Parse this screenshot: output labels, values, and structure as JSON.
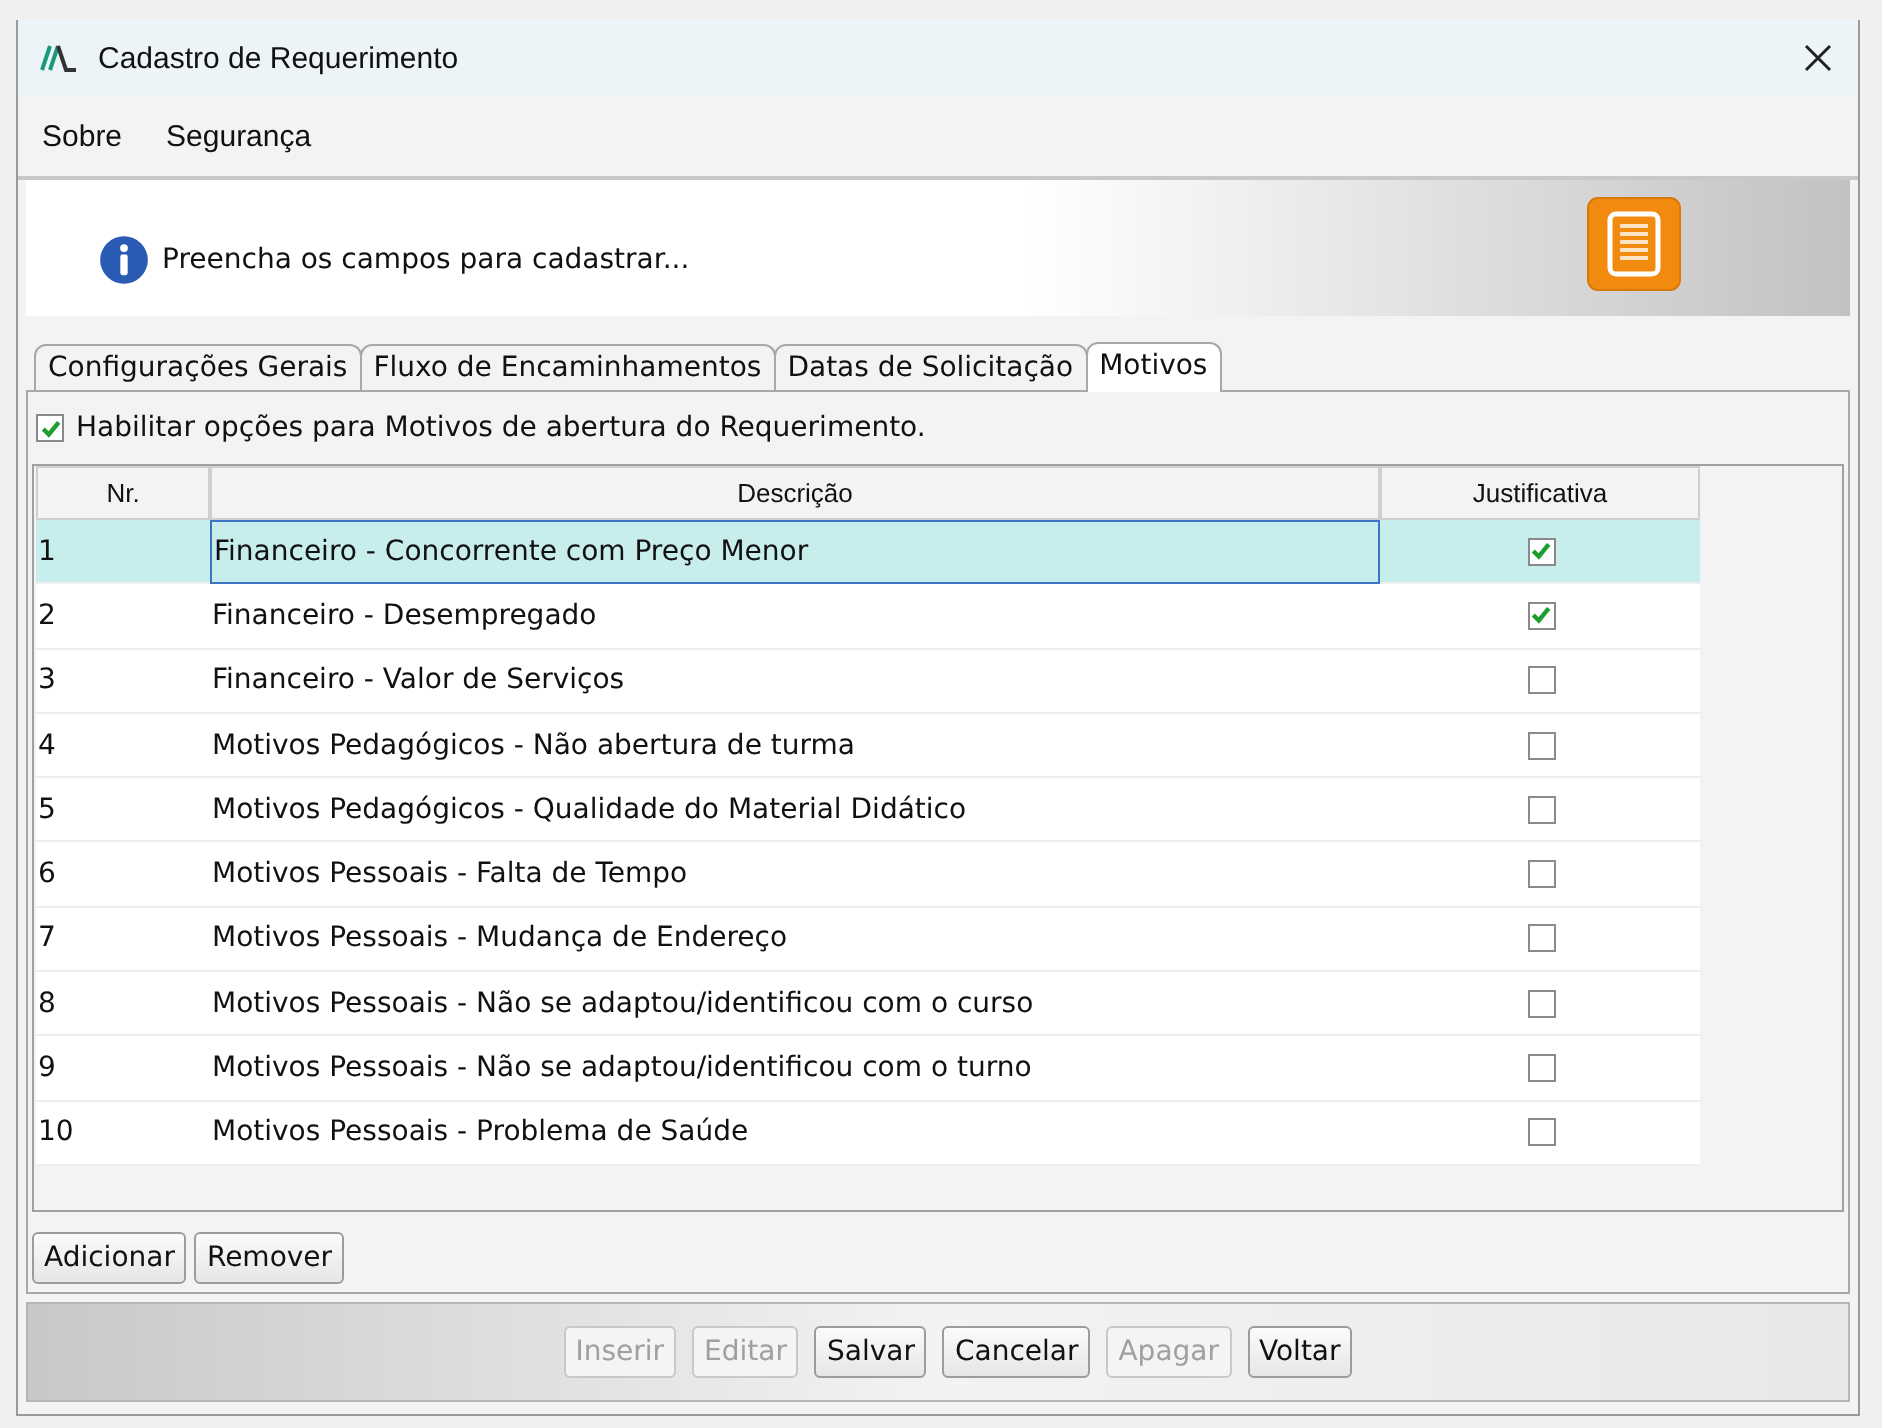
{
  "window": {
    "title": "Cadastro de Requerimento"
  },
  "menu": [
    "Sobre",
    "Segurança"
  ],
  "header": {
    "message": "Preencha os campos para cadastrar..."
  },
  "tabs": [
    {
      "label": "Configurações Gerais",
      "selected": false
    },
    {
      "label": "Fluxo de Encaminhamentos",
      "selected": false
    },
    {
      "label": "Datas de Solicitação",
      "selected": false
    },
    {
      "label": "Motivos",
      "selected": true
    }
  ],
  "enable_option": {
    "label": "Habilitar opções para Motivos de abertura do Requerimento.",
    "checked": true
  },
  "table": {
    "columns": [
      "Nr.",
      "Descrição",
      "Justificativa"
    ],
    "rows": [
      {
        "nr": "1",
        "description": "Financeiro - Concorrente com Preço Menor",
        "justificativa": true,
        "selected": true
      },
      {
        "nr": "2",
        "description": "Financeiro - Desempregado",
        "justificativa": true,
        "selected": false
      },
      {
        "nr": "3",
        "description": "Financeiro - Valor de Serviços",
        "justificativa": false,
        "selected": false
      },
      {
        "nr": "4",
        "description": "Motivos Pedagógicos - Não abertura de turma",
        "justificativa": false,
        "selected": false
      },
      {
        "nr": "5",
        "description": "Motivos Pedagógicos - Qualidade do Material Didático",
        "justificativa": false,
        "selected": false
      },
      {
        "nr": "6",
        "description": "Motivos Pessoais - Falta de Tempo",
        "justificativa": false,
        "selected": false
      },
      {
        "nr": "7",
        "description": "Motivos Pessoais - Mudança de Endereço",
        "justificativa": false,
        "selected": false
      },
      {
        "nr": "8",
        "description": "Motivos Pessoais - Não se adaptou/identificou com o curso",
        "justificativa": false,
        "selected": false
      },
      {
        "nr": "9",
        "description": "Motivos Pessoais - Não se adaptou/identificou com o turno",
        "justificativa": false,
        "selected": false
      },
      {
        "nr": "10",
        "description": "Motivos Pessoais - Problema de Saúde",
        "justificativa": false,
        "selected": false
      }
    ]
  },
  "table_buttons": [
    "Adicionar",
    "Remover"
  ],
  "footer_buttons": [
    {
      "label": "Inserir",
      "disabled": true
    },
    {
      "label": "Editar",
      "disabled": true
    },
    {
      "label": "Salvar",
      "disabled": false
    },
    {
      "label": "Cancelar",
      "disabled": false
    },
    {
      "label": "Apagar",
      "disabled": true
    },
    {
      "label": "Voltar",
      "disabled": false
    }
  ]
}
